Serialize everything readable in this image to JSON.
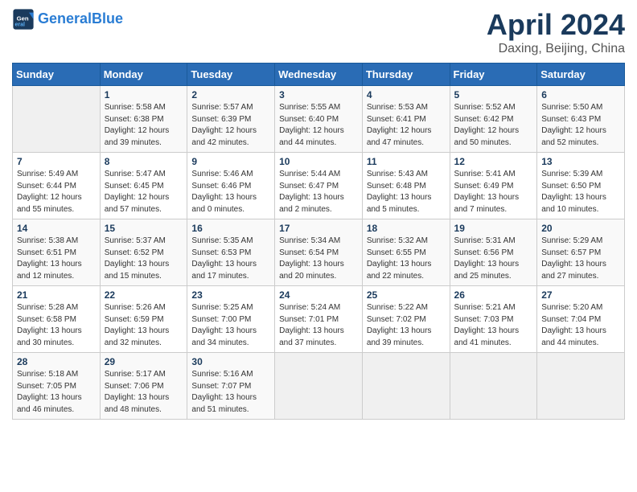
{
  "logo": {
    "line1": "General",
    "line2": "Blue"
  },
  "title": "April 2024",
  "subtitle": "Daxing, Beijing, China",
  "weekdays": [
    "Sunday",
    "Monday",
    "Tuesday",
    "Wednesday",
    "Thursday",
    "Friday",
    "Saturday"
  ],
  "weeks": [
    [
      {
        "day": "",
        "info": ""
      },
      {
        "day": "1",
        "info": "Sunrise: 5:58 AM\nSunset: 6:38 PM\nDaylight: 12 hours\nand 39 minutes."
      },
      {
        "day": "2",
        "info": "Sunrise: 5:57 AM\nSunset: 6:39 PM\nDaylight: 12 hours\nand 42 minutes."
      },
      {
        "day": "3",
        "info": "Sunrise: 5:55 AM\nSunset: 6:40 PM\nDaylight: 12 hours\nand 44 minutes."
      },
      {
        "day": "4",
        "info": "Sunrise: 5:53 AM\nSunset: 6:41 PM\nDaylight: 12 hours\nand 47 minutes."
      },
      {
        "day": "5",
        "info": "Sunrise: 5:52 AM\nSunset: 6:42 PM\nDaylight: 12 hours\nand 50 minutes."
      },
      {
        "day": "6",
        "info": "Sunrise: 5:50 AM\nSunset: 6:43 PM\nDaylight: 12 hours\nand 52 minutes."
      }
    ],
    [
      {
        "day": "7",
        "info": "Sunrise: 5:49 AM\nSunset: 6:44 PM\nDaylight: 12 hours\nand 55 minutes."
      },
      {
        "day": "8",
        "info": "Sunrise: 5:47 AM\nSunset: 6:45 PM\nDaylight: 12 hours\nand 57 minutes."
      },
      {
        "day": "9",
        "info": "Sunrise: 5:46 AM\nSunset: 6:46 PM\nDaylight: 13 hours\nand 0 minutes."
      },
      {
        "day": "10",
        "info": "Sunrise: 5:44 AM\nSunset: 6:47 PM\nDaylight: 13 hours\nand 2 minutes."
      },
      {
        "day": "11",
        "info": "Sunrise: 5:43 AM\nSunset: 6:48 PM\nDaylight: 13 hours\nand 5 minutes."
      },
      {
        "day": "12",
        "info": "Sunrise: 5:41 AM\nSunset: 6:49 PM\nDaylight: 13 hours\nand 7 minutes."
      },
      {
        "day": "13",
        "info": "Sunrise: 5:39 AM\nSunset: 6:50 PM\nDaylight: 13 hours\nand 10 minutes."
      }
    ],
    [
      {
        "day": "14",
        "info": "Sunrise: 5:38 AM\nSunset: 6:51 PM\nDaylight: 13 hours\nand 12 minutes."
      },
      {
        "day": "15",
        "info": "Sunrise: 5:37 AM\nSunset: 6:52 PM\nDaylight: 13 hours\nand 15 minutes."
      },
      {
        "day": "16",
        "info": "Sunrise: 5:35 AM\nSunset: 6:53 PM\nDaylight: 13 hours\nand 17 minutes."
      },
      {
        "day": "17",
        "info": "Sunrise: 5:34 AM\nSunset: 6:54 PM\nDaylight: 13 hours\nand 20 minutes."
      },
      {
        "day": "18",
        "info": "Sunrise: 5:32 AM\nSunset: 6:55 PM\nDaylight: 13 hours\nand 22 minutes."
      },
      {
        "day": "19",
        "info": "Sunrise: 5:31 AM\nSunset: 6:56 PM\nDaylight: 13 hours\nand 25 minutes."
      },
      {
        "day": "20",
        "info": "Sunrise: 5:29 AM\nSunset: 6:57 PM\nDaylight: 13 hours\nand 27 minutes."
      }
    ],
    [
      {
        "day": "21",
        "info": "Sunrise: 5:28 AM\nSunset: 6:58 PM\nDaylight: 13 hours\nand 30 minutes."
      },
      {
        "day": "22",
        "info": "Sunrise: 5:26 AM\nSunset: 6:59 PM\nDaylight: 13 hours\nand 32 minutes."
      },
      {
        "day": "23",
        "info": "Sunrise: 5:25 AM\nSunset: 7:00 PM\nDaylight: 13 hours\nand 34 minutes."
      },
      {
        "day": "24",
        "info": "Sunrise: 5:24 AM\nSunset: 7:01 PM\nDaylight: 13 hours\nand 37 minutes."
      },
      {
        "day": "25",
        "info": "Sunrise: 5:22 AM\nSunset: 7:02 PM\nDaylight: 13 hours\nand 39 minutes."
      },
      {
        "day": "26",
        "info": "Sunrise: 5:21 AM\nSunset: 7:03 PM\nDaylight: 13 hours\nand 41 minutes."
      },
      {
        "day": "27",
        "info": "Sunrise: 5:20 AM\nSunset: 7:04 PM\nDaylight: 13 hours\nand 44 minutes."
      }
    ],
    [
      {
        "day": "28",
        "info": "Sunrise: 5:18 AM\nSunset: 7:05 PM\nDaylight: 13 hours\nand 46 minutes."
      },
      {
        "day": "29",
        "info": "Sunrise: 5:17 AM\nSunset: 7:06 PM\nDaylight: 13 hours\nand 48 minutes."
      },
      {
        "day": "30",
        "info": "Sunrise: 5:16 AM\nSunset: 7:07 PM\nDaylight: 13 hours\nand 51 minutes."
      },
      {
        "day": "",
        "info": ""
      },
      {
        "day": "",
        "info": ""
      },
      {
        "day": "",
        "info": ""
      },
      {
        "day": "",
        "info": ""
      }
    ]
  ]
}
